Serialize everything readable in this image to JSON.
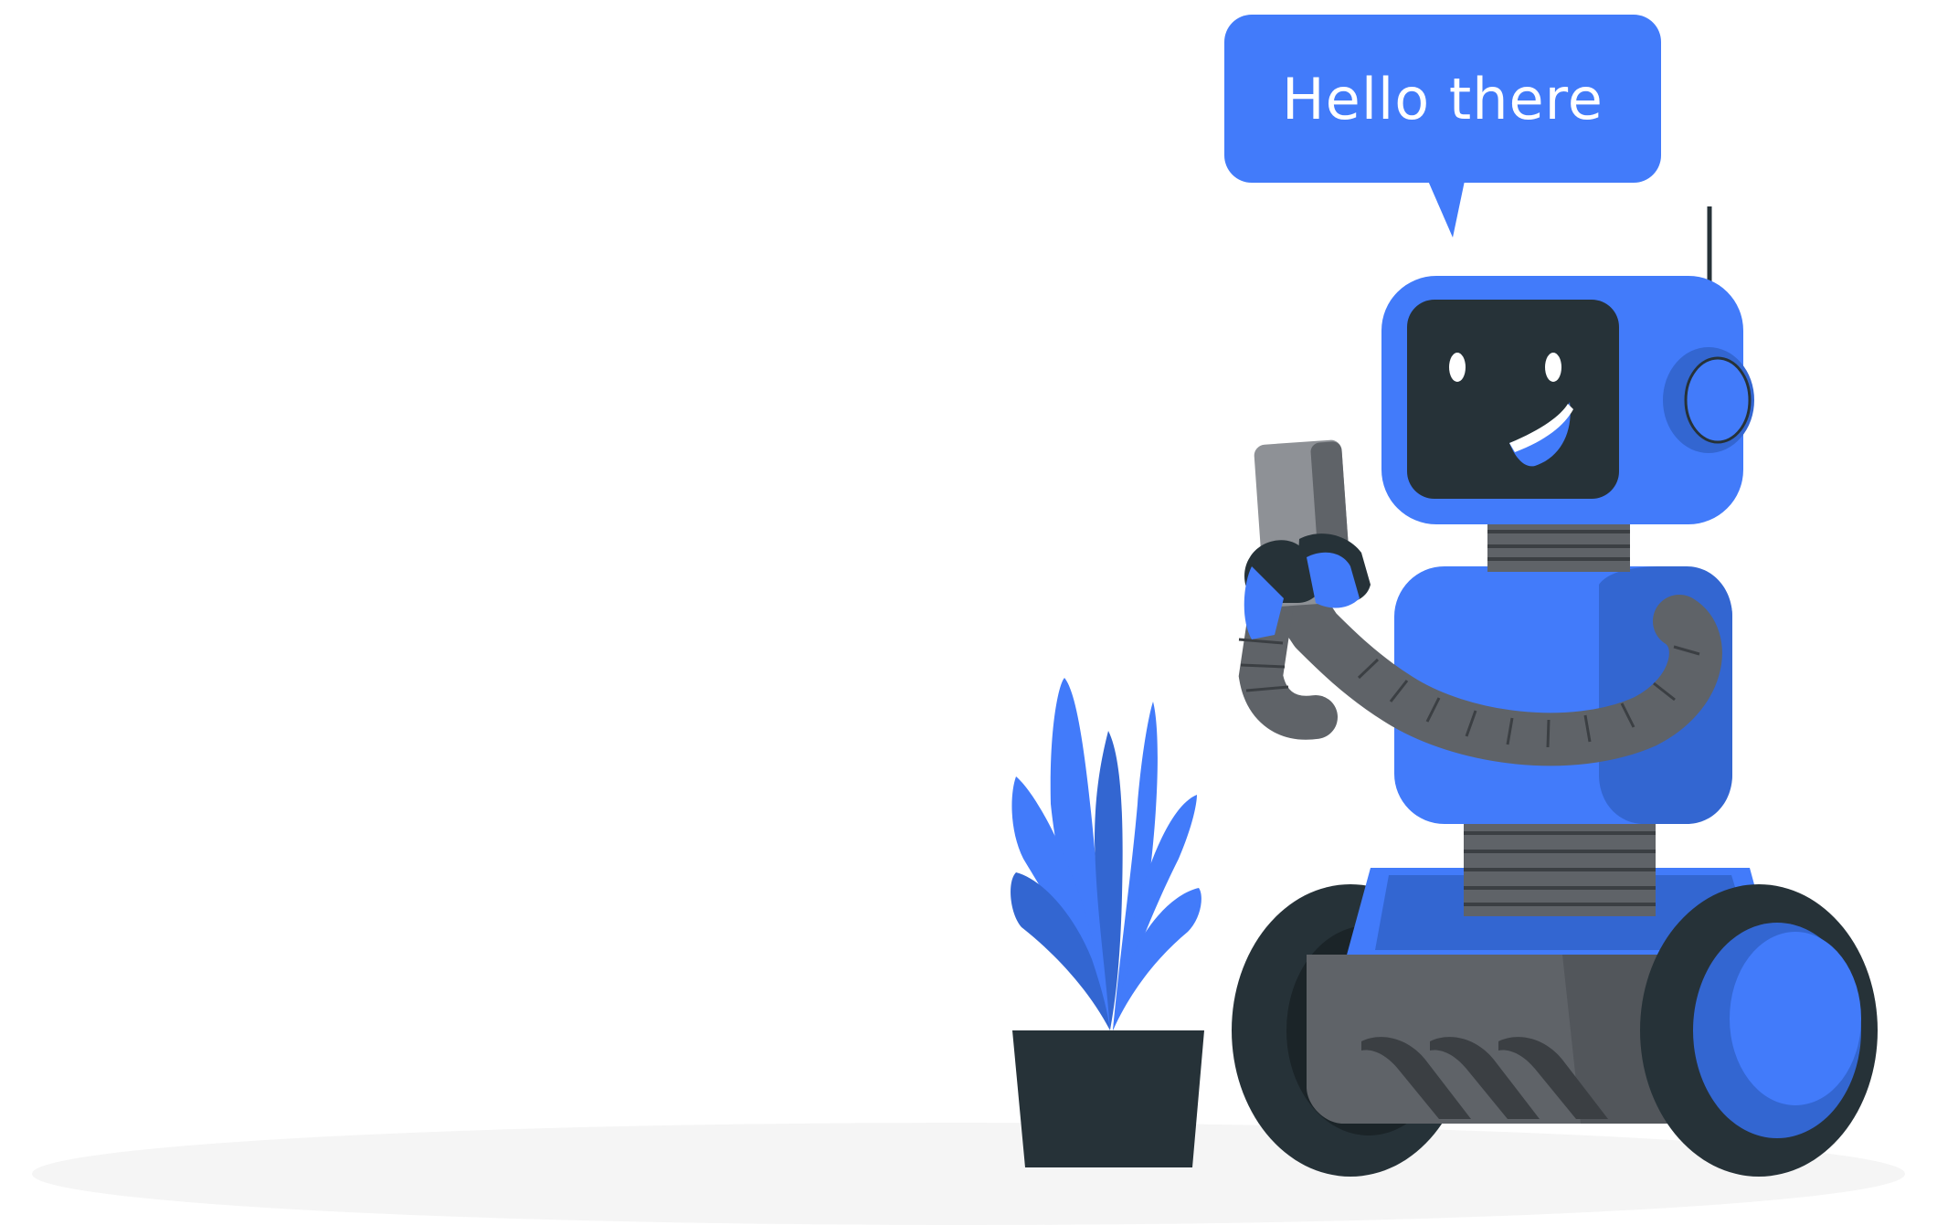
{
  "speech_bubble": {
    "text": "Hello there"
  },
  "colors": {
    "background": "#ffffff",
    "brand_blue": "#427BFA",
    "dark_blue": "#3366D1",
    "charcoal": "#263238",
    "gray": "#5F6368",
    "light_gray": "#8E9196",
    "floor_shadow": "#F5F5F5"
  },
  "illustration": {
    "subject_icon": "robot-icon",
    "props": [
      "smartphone-icon",
      "potted-plant-icon"
    ]
  }
}
